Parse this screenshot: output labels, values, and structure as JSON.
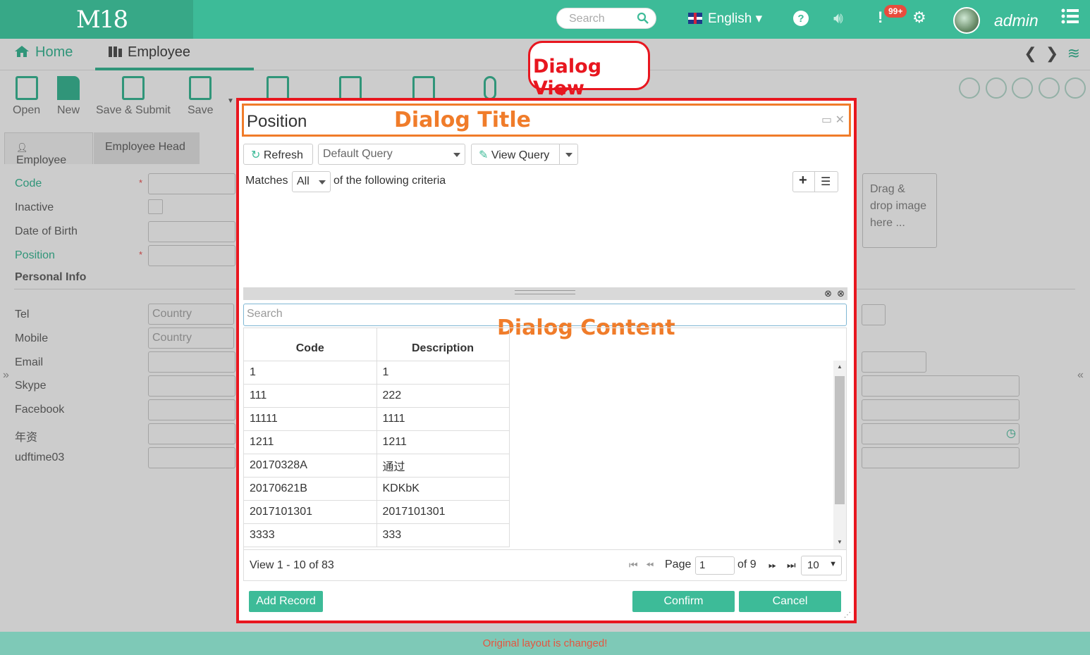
{
  "topbar": {
    "logo": "M18",
    "search_placeholder": "Search",
    "language": "English",
    "notification_badge": "99+",
    "user": "admin"
  },
  "tabs": {
    "home": "Home",
    "employee": "Employee"
  },
  "toolbar": {
    "open": "Open",
    "new": "New",
    "save_submit": "Save & Submit",
    "save": "Save"
  },
  "subtabs": {
    "employee": "Employee",
    "employee_head": "Employee Head"
  },
  "form": {
    "code": "Code",
    "inactive": "Inactive",
    "dob": "Date of Birth",
    "position": "Position",
    "personal_info": "Personal Info",
    "tel": "Tel",
    "mobile": "Mobile",
    "email": "Email",
    "skype": "Skype",
    "facebook": "Facebook",
    "seniority": "年资",
    "udftime03": "udftime03",
    "country_placeholder": "Country",
    "dropzone": "Drag & drop image here ..."
  },
  "callout": "Dialog View",
  "dialog": {
    "title": "Position",
    "title_annotation": "Dialog Title",
    "content_annotation": "Dialog Content",
    "refresh": "Refresh",
    "query": "Default Query",
    "view_query": "View Query",
    "matches": "Matches",
    "matches_value": "All",
    "criteria_text": "of the following criteria",
    "search_placeholder": "Search",
    "columns": [
      "Code",
      "Description"
    ],
    "rows": [
      [
        "1",
        "1"
      ],
      [
        "111",
        "222"
      ],
      [
        "11111",
        "1111"
      ],
      [
        "1211",
        "1211"
      ],
      [
        "20170328A",
        "通过"
      ],
      [
        "20170621B",
        "KDKbK"
      ],
      [
        "2017101301",
        "2017101301"
      ],
      [
        "3333",
        "333"
      ]
    ],
    "pager": {
      "info": "View 1 - 10 of 83",
      "page_label": "Page",
      "page_value": "1",
      "of_label": "of 9",
      "page_size": "10"
    },
    "add_record": "Add Record",
    "confirm": "Confirm",
    "cancel": "Cancel"
  },
  "footer": "Original layout is changed!",
  "colors": {
    "brand": "#3dbb98",
    "annotation_red": "#e8161f",
    "annotation_orange": "#f07c2a"
  }
}
